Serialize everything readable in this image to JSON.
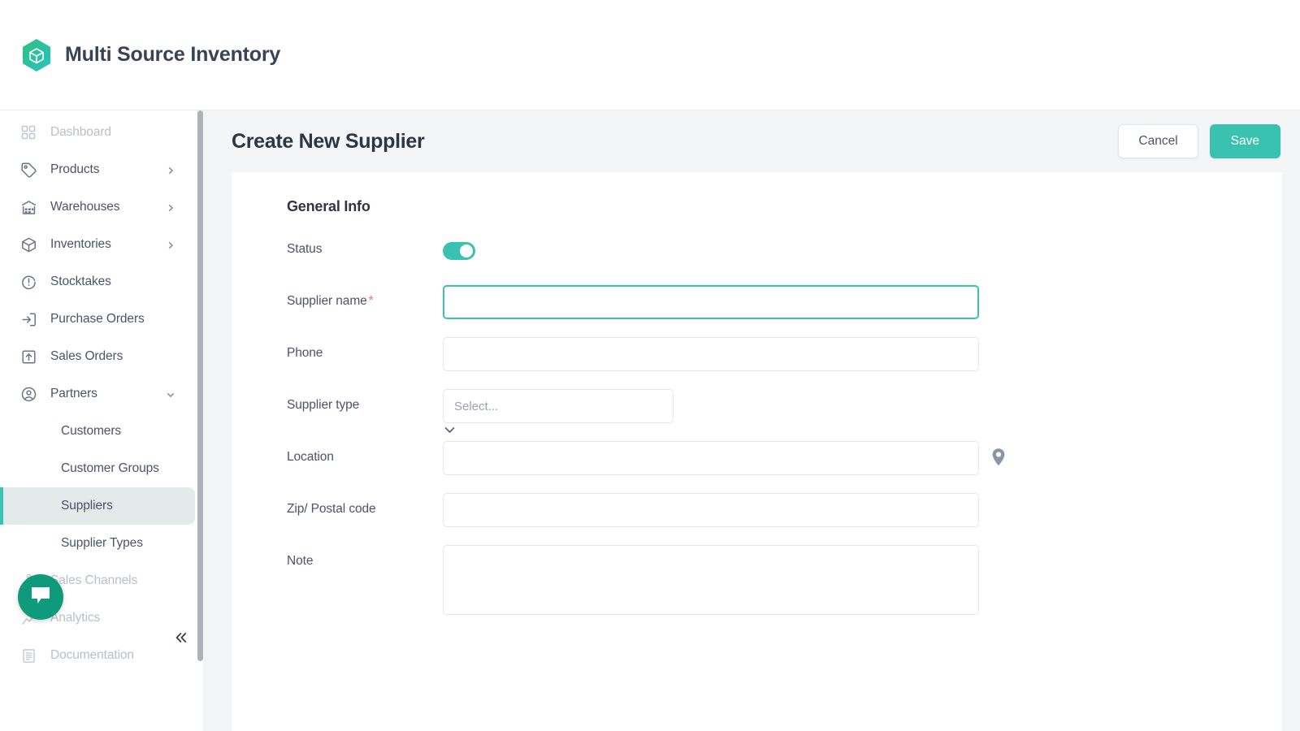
{
  "app": {
    "title": "Multi Source Inventory",
    "logo_icon": "cube-hexagon-logo"
  },
  "sidebar": {
    "items": [
      {
        "label": "Dashboard",
        "icon": "grid-icon",
        "dim": true,
        "expandable": false
      },
      {
        "label": "Products",
        "icon": "tag-icon",
        "dim": false,
        "expandable": true
      },
      {
        "label": "Warehouses",
        "icon": "warehouse-icon",
        "dim": false,
        "expandable": true
      },
      {
        "label": "Inventories",
        "icon": "box-icon",
        "dim": false,
        "expandable": true
      },
      {
        "label": "Stocktakes",
        "icon": "clipboard-check-icon",
        "dim": false,
        "expandable": false
      },
      {
        "label": "Purchase Orders",
        "icon": "arrow-in-icon",
        "dim": false,
        "expandable": false
      },
      {
        "label": "Sales Orders",
        "icon": "arrow-out-icon",
        "dim": false,
        "expandable": false
      },
      {
        "label": "Partners",
        "icon": "user-circle-icon",
        "dim": false,
        "expandable": true,
        "expanded": true
      }
    ],
    "partners_children": [
      {
        "label": "Customers",
        "active": false
      },
      {
        "label": "Customer Groups",
        "active": false
      },
      {
        "label": "Suppliers",
        "active": true
      },
      {
        "label": "Supplier Types",
        "active": false
      }
    ],
    "tail_items": [
      {
        "label": "Sales Channels",
        "icon": "share-network-icon",
        "dim": true
      },
      {
        "label": "Analytics",
        "icon": "analytics-icon",
        "dim": true
      },
      {
        "label": "Documentation",
        "icon": "document-icon",
        "dim": true
      }
    ],
    "collapse_icon": "chevron-double-left-icon",
    "chat_fab_icon": "chat-bubble-icon"
  },
  "page": {
    "title": "Create New Supplier",
    "cancel_label": "Cancel",
    "save_label": "Save"
  },
  "form": {
    "section_title": "General Info",
    "fields": {
      "status": {
        "label": "Status",
        "type": "toggle",
        "value": "on"
      },
      "supplier_name": {
        "label": "Supplier name",
        "required_mark": "*",
        "type": "text",
        "value": "",
        "focused": true
      },
      "phone": {
        "label": "Phone",
        "type": "text",
        "value": ""
      },
      "supplier_type": {
        "label": "Supplier type",
        "type": "select",
        "placeholder": "Select...",
        "value": ""
      },
      "location": {
        "label": "Location",
        "type": "text",
        "value": "",
        "trailing_icon": "map-pin-icon"
      },
      "zip": {
        "label": "Zip/ Postal code",
        "type": "text",
        "value": ""
      },
      "note": {
        "label": "Note",
        "type": "textarea",
        "value": ""
      }
    }
  },
  "colors": {
    "accent_teal": "#3ac2b1",
    "fab_green": "#0d9b7c",
    "required_red": "#ff6b63",
    "active_bg": "#e3ebea",
    "page_bg": "#f4f5f7",
    "text_dark": "#2f3545",
    "text_muted": "#4b5468"
  }
}
